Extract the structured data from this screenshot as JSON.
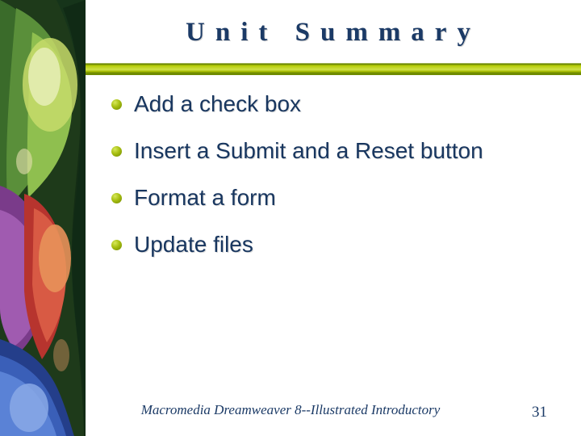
{
  "title": "Unit Summary",
  "bullets": [
    "Add a check box",
    "Insert a Submit and a Reset button",
    "Format a form",
    "Update files"
  ],
  "footer": "Macromedia Dreamweaver 8--Illustrated Introductory",
  "page_number": "31"
}
